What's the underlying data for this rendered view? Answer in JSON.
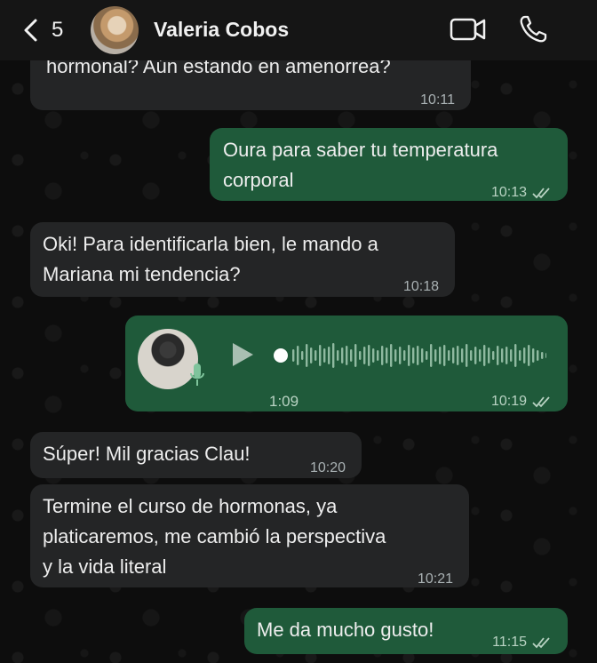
{
  "header": {
    "back_count": "5",
    "contact_name": "Valeria Cobos"
  },
  "messages": [
    {
      "dir": "in",
      "text": "hormonal? Aún estando en amenorrea?",
      "time": "10:11"
    },
    {
      "dir": "out",
      "text": "Oura para saber tu temperatura\ncorporal",
      "time": "10:13"
    },
    {
      "dir": "in",
      "text": "Oki! Para identificarla bien, le mando a\nMariana mi tendencia?",
      "time": "10:18"
    },
    {
      "dir": "out",
      "type": "voice",
      "duration": "1:09",
      "time": "10:19"
    },
    {
      "dir": "in",
      "text": "Súper! Mil gracias Clau!",
      "time": "10:20"
    },
    {
      "dir": "in",
      "text": "Termine el curso de hormonas, ya\nplaticaremos, me cambió la perspectiva\ny la vida literal",
      "time": "10:21"
    },
    {
      "dir": "out",
      "text": "Me da mucho gusto!",
      "time": "11:15"
    }
  ],
  "colors": {
    "incoming_bubble": "#242526",
    "outgoing_bubble": "#1f5a3a",
    "header_bg": "#151515"
  },
  "icons": [
    "chevron-left-icon",
    "video-call-icon",
    "phone-icon",
    "play-icon",
    "mic-icon",
    "double-check-icon"
  ]
}
